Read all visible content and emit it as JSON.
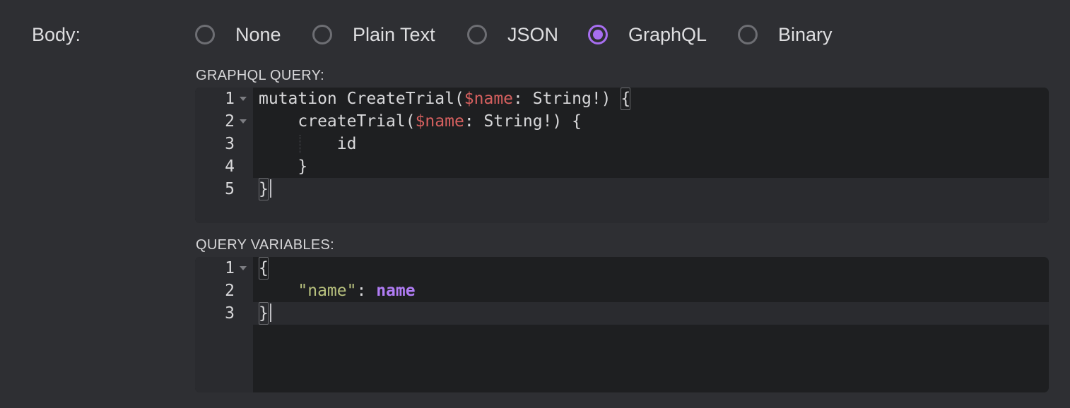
{
  "body_label": "Body:",
  "body_types": [
    {
      "label": "None",
      "selected": false
    },
    {
      "label": "Plain Text",
      "selected": false
    },
    {
      "label": "JSON",
      "selected": false
    },
    {
      "label": "GraphQL",
      "selected": true
    },
    {
      "label": "Binary",
      "selected": false
    }
  ],
  "accent_color": "#a76ef0",
  "graphql_query": {
    "label": "GRAPHQL QUERY:",
    "lines": [
      {
        "number": "1",
        "parts": [
          "mutation CreateTrial(",
          "$name",
          ": String!) ",
          "{"
        ]
      },
      {
        "number": "2",
        "parts": [
          "    createTrial(",
          "$name",
          ": String!) {"
        ]
      },
      {
        "number": "3",
        "parts": [
          "        id"
        ]
      },
      {
        "number": "4",
        "parts": [
          "    }"
        ]
      },
      {
        "number": "5",
        "parts": [
          "}"
        ]
      }
    ]
  },
  "query_variables": {
    "label": "QUERY VARIABLES:",
    "lines": [
      {
        "number": "1",
        "parts": [
          "{"
        ]
      },
      {
        "number": "2",
        "parts": [
          "    ",
          "\"name\"",
          ": ",
          "name"
        ]
      },
      {
        "number": "3",
        "parts": [
          "}"
        ]
      }
    ]
  }
}
